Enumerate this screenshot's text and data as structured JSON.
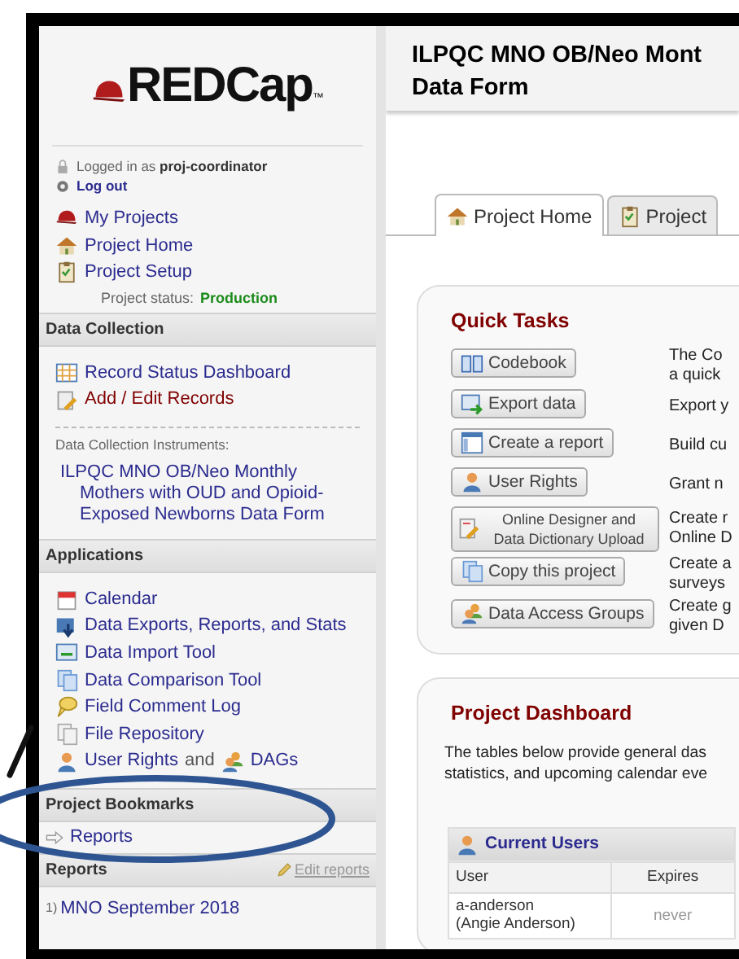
{
  "logo": {
    "text": "REDCap",
    "trademark": "™"
  },
  "account": {
    "logged_in": "Logged in as **proj-coordinator**",
    "logout": "Log out"
  },
  "nav_links": [
    {
      "label": "My Projects"
    },
    {
      "label": "Project Home"
    },
    {
      "label": "Project Setup"
    }
  ],
  "project_status": {
    "label": "Project status:",
    "value": "Production"
  },
  "data_collection": {
    "title": "Data Collection",
    "links": [
      {
        "label": "Record Status Dashboard",
        "visited": false
      },
      {
        "label": "Add / Edit Records",
        "visited": true
      }
    ],
    "instruments_label": "Data Collection Instruments:",
    "instruments": [
      "ILPQC MNO OB/Neo Monthly Mothers with OUD and Opioid-Exposed Newborns Data Form"
    ]
  },
  "applications": {
    "title": "Applications",
    "links": [
      {
        "label": "Calendar"
      },
      {
        "label": "Data Exports, Reports, and Stats"
      },
      {
        "label": "Data Import Tool"
      },
      {
        "label": "Data Comparison Tool"
      },
      {
        "label": "Field Comment Log"
      },
      {
        "label": "File Repository"
      }
    ],
    "last_row": {
      "first": "User Rights",
      "joiner": "and",
      "second": "DAGs"
    }
  },
  "bookmarks": {
    "title": "Project Bookmarks",
    "links": [
      "Reports"
    ]
  },
  "reports": {
    "title": "Reports",
    "edit_link": "Edit reports",
    "items": [
      {
        "number": "1)",
        "label": "MNO September 2018"
      }
    ]
  },
  "page_title": "ILPQC MNO OB/Neo Mont\nData Form",
  "tabs": [
    {
      "label": "Project Home",
      "selected": true
    },
    {
      "label": "Project",
      "selected": false
    }
  ],
  "quick_tasks": {
    "title": "Quick Tasks",
    "tasks": [
      {
        "button": "Codebook",
        "description": "The Co\na quick"
      },
      {
        "button": "Export data",
        "description": "Export y"
      },
      {
        "button": "Create a report",
        "description": "Build cu"
      },
      {
        "button": "User Rights",
        "description": "Grant n"
      },
      {
        "button": "Online Designer and Data Dictionary Upload",
        "description": "Create r\nOnline D"
      },
      {
        "button": "Copy this project",
        "description": "Create a\nsurveys"
      },
      {
        "button": "Data Access Groups",
        "description": "Create g\ngiven D"
      }
    ]
  },
  "dashboard": {
    "title": "Project Dashboard",
    "description": "The tables below provide general das\nstatistics, and upcoming calendar eve",
    "table": {
      "title": "Current Users",
      "columns": [
        "User",
        "Expires"
      ],
      "rows": [
        [
          "a-anderson\n(Angie Anderson)",
          "never"
        ]
      ]
    }
  }
}
